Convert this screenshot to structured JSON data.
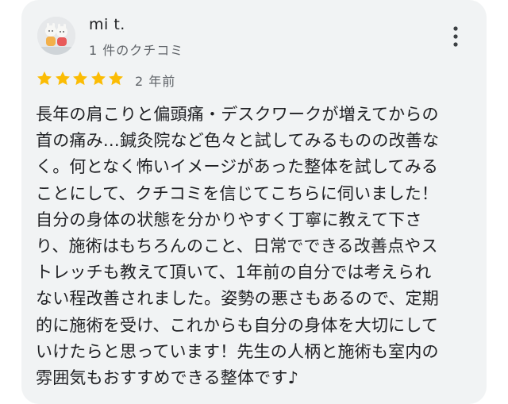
{
  "reviewer": {
    "name": "mi t.",
    "review_count": "1 件のクチコミ"
  },
  "rating": {
    "stars": 5,
    "star_color": "#fbbc04",
    "date": "2 年前"
  },
  "review": {
    "text": "長年の肩こりと偏頭痛・デスクワークが増えてからの\n首の痛み…鍼灸院など色々と試してみるものの改善な\nく。何となく怖いイメージがあった整体を試してみる\nことにして、クチコミを信じてこちらに伺いました！\n自分の身体の状態を分かりやすく丁寧に教えて下さ\nり、施術はもちろんのこと、日常でできる改善点やス\nトレッチも教えて頂いて、1年前の自分では考えられ\nない程改善されました。姿勢の悪さもあるので、定期\n的に施術を受け、これからも自分の身体を大切にして\nいけたらと思っています！先生の人柄と施術も室内の\n雰囲気もおすすめできる整体です♪"
  },
  "icons": {
    "menu": "more-vert-icon",
    "star": "star-icon",
    "avatar": "avatar"
  }
}
